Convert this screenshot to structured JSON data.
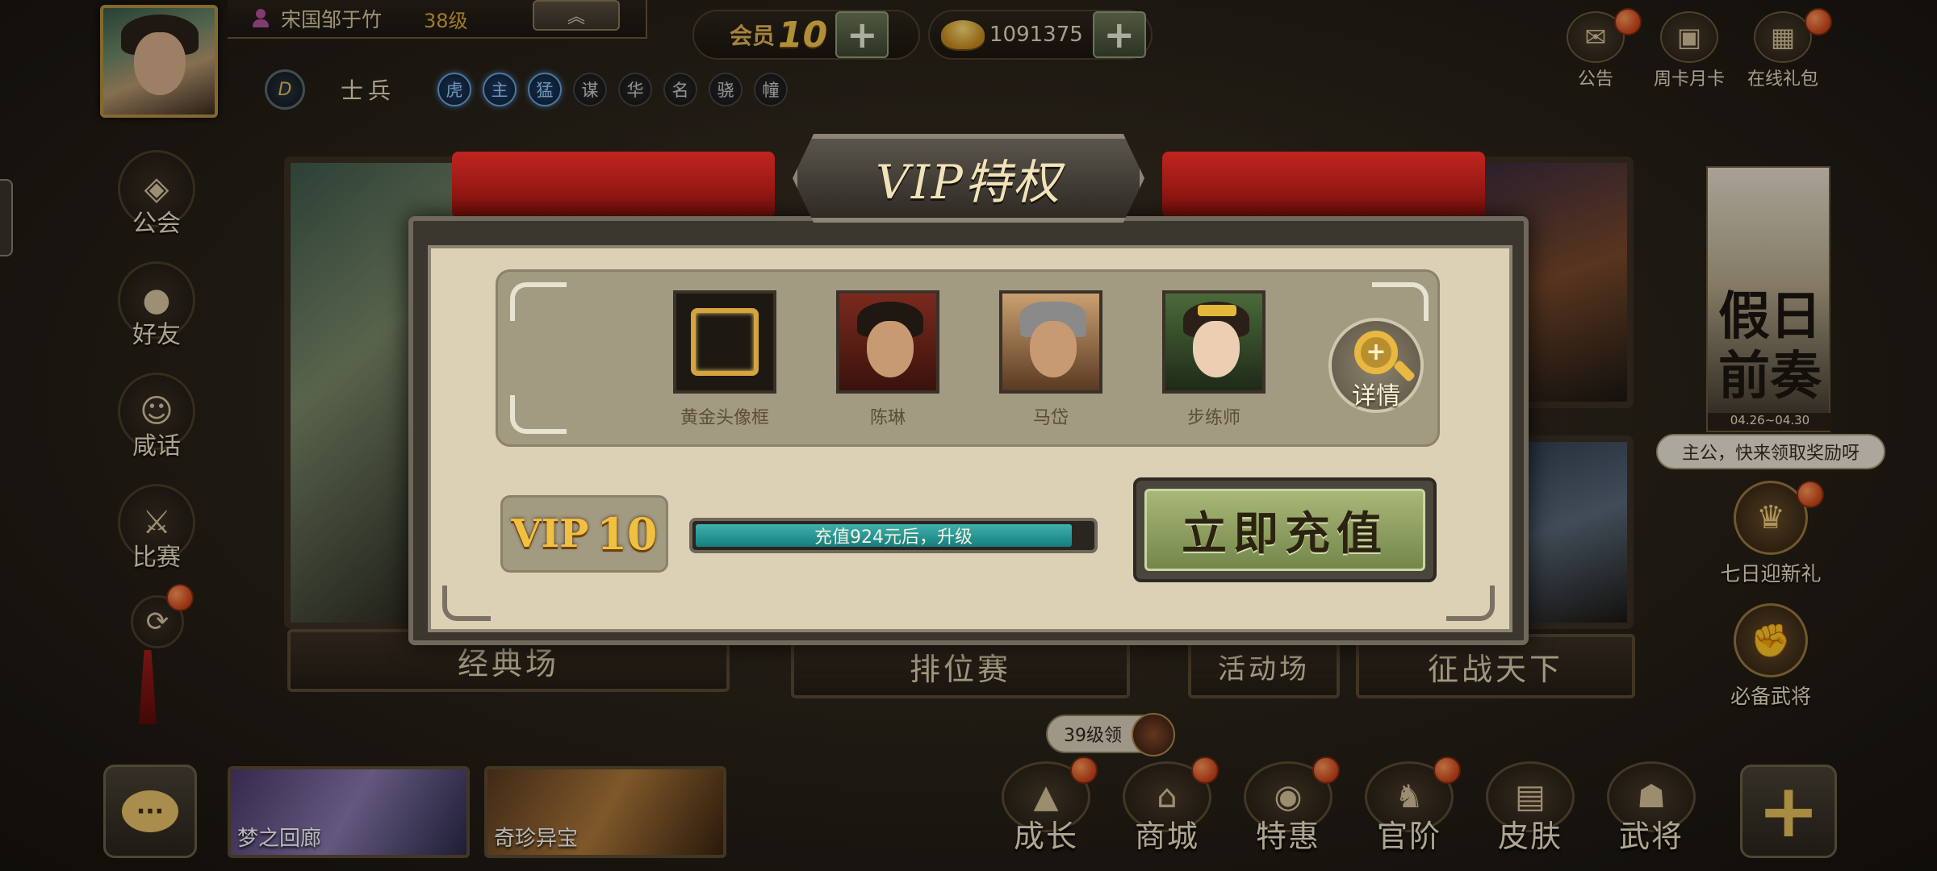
{
  "player": {
    "name": "宋国邹于竹",
    "level": "38级",
    "collapse_icon": "chevrons-up-icon",
    "role_name": "士兵",
    "traits": [
      {
        "label": "虎",
        "active": true
      },
      {
        "label": "主",
        "active": true
      },
      {
        "label": "猛",
        "active": true
      },
      {
        "label": "谋",
        "active": false
      },
      {
        "label": "华",
        "active": false
      },
      {
        "label": "名",
        "active": false
      },
      {
        "label": "骁",
        "active": false
      },
      {
        "label": "幢",
        "active": false
      }
    ]
  },
  "top_bar": {
    "member_label": "会员",
    "member_level": "10",
    "gold": "1091375"
  },
  "top_right": [
    {
      "label": "公告",
      "icon": "announcement-icon",
      "dot": true
    },
    {
      "label": "周卡月卡",
      "icon": "card-icon",
      "dot": false
    },
    {
      "label": "在线礼包",
      "icon": "gift-icon",
      "dot": true
    }
  ],
  "left_menu": [
    {
      "label": "公会",
      "icon": "guild-icon"
    },
    {
      "label": "好友",
      "icon": "friends-icon"
    },
    {
      "label": "咸话",
      "icon": "chat-face-icon"
    },
    {
      "label": "比赛",
      "icon": "crossed-swords-icon"
    }
  ],
  "modes": {
    "classic": "经典场",
    "ranked": "排位赛",
    "event": "活动场",
    "conquest": "征战天下"
  },
  "right_panel": {
    "banner_title": "假日前奏",
    "banner_date": "04.26~04.30",
    "bubble_text": "主公，快来领取奖励呀",
    "seven_day_label": "七日迎新礼",
    "essential_label": "必备武将"
  },
  "bottom": {
    "level_bubble": "39级领",
    "events": [
      {
        "label": "梦之回廊"
      },
      {
        "label": "奇珍异宝"
      }
    ],
    "nav": [
      {
        "label": "成长",
        "icon": "growth-icon",
        "dot": true
      },
      {
        "label": "商城",
        "icon": "shop-icon",
        "dot": true
      },
      {
        "label": "特惠",
        "icon": "discount-icon",
        "dot": true
      },
      {
        "label": "官阶",
        "icon": "rank-icon",
        "dot": true
      },
      {
        "label": "皮肤",
        "icon": "skin-icon",
        "dot": false
      },
      {
        "label": "武将",
        "icon": "general-icon",
        "dot": false
      }
    ]
  },
  "vip_modal": {
    "title": "VIP特权",
    "rewards": [
      {
        "name": "黄金头像框",
        "kind": "frame"
      },
      {
        "name": "陈琳",
        "kind": "portrait"
      },
      {
        "name": "马岱",
        "kind": "portrait"
      },
      {
        "name": "步练师",
        "kind": "portrait"
      }
    ],
    "detail_label": "详情",
    "vip_prefix": "VIP",
    "vip_level": "10",
    "progress_text": "充值924元后，升级",
    "progress_fraction": 0.95,
    "recharge_label": "立即充值"
  },
  "colors": {
    "accent_gold": "#f2c040",
    "progress_teal": "#3fb0ad",
    "ribbon_red": "#c0251e",
    "notify_orange": "#d0431a"
  }
}
